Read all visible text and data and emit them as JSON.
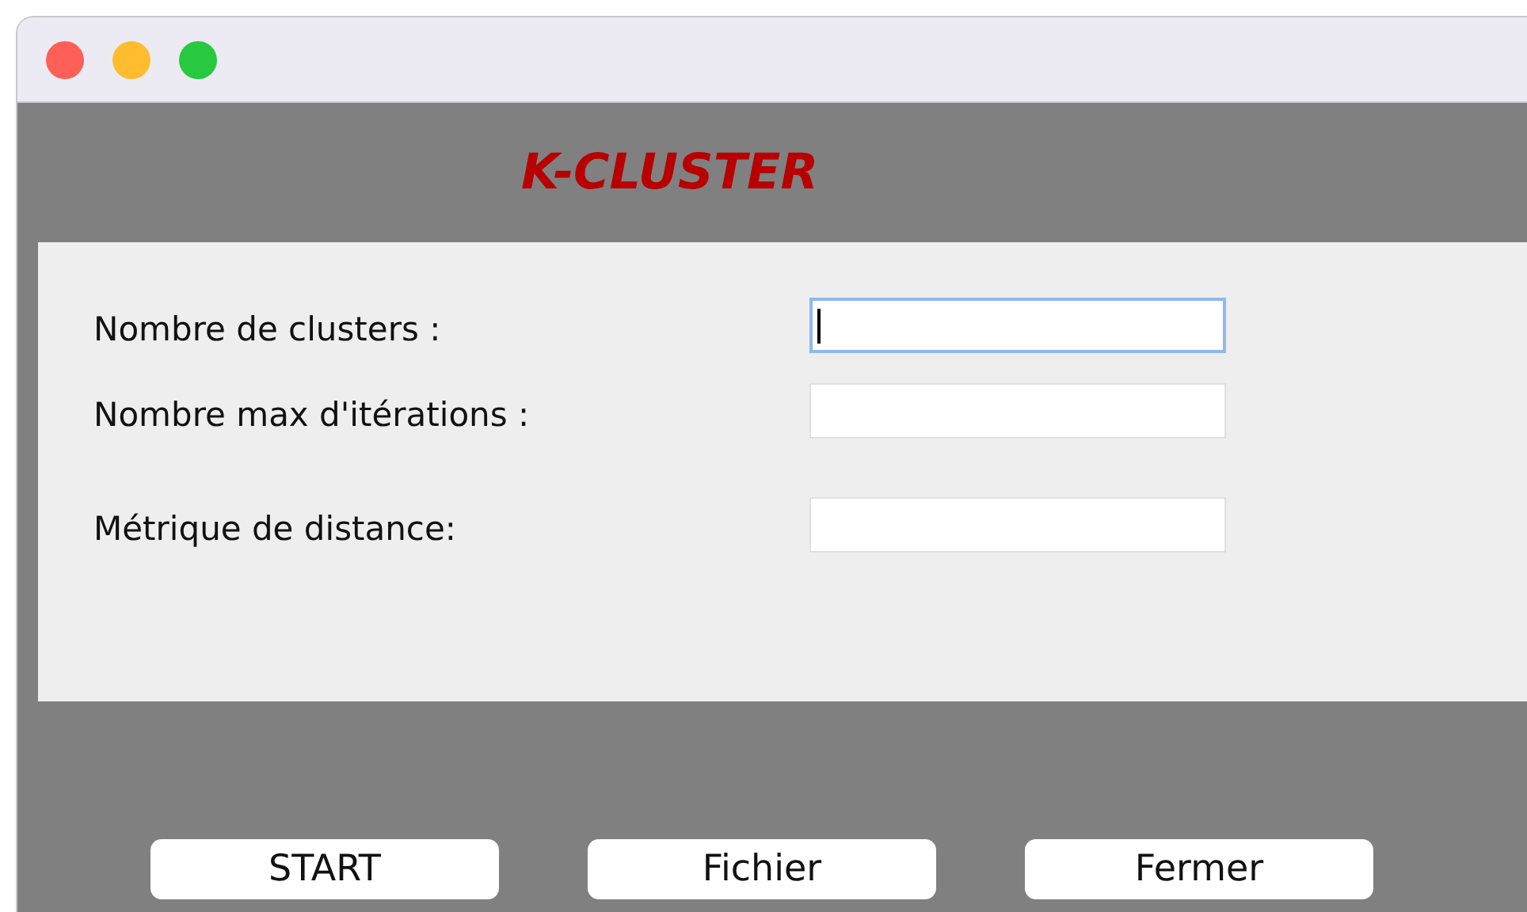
{
  "app_title": "K-CLUSTER",
  "fields": [
    {
      "label": "Nombre de clusters :",
      "focused": true
    },
    {
      "label": "Nombre max d'itérations :",
      "focused": false
    },
    {
      "label": "Métrique de distance:",
      "focused": false
    }
  ],
  "buttons": [
    "START",
    "Fichier",
    "Fermer"
  ]
}
